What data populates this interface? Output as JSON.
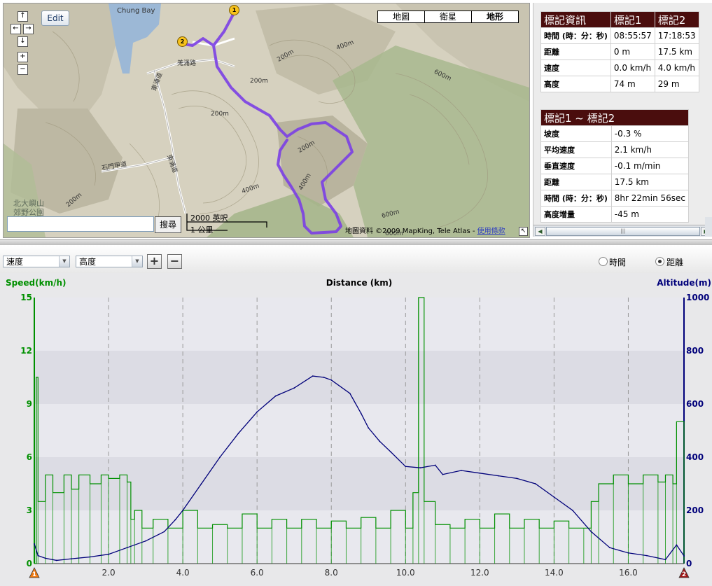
{
  "map": {
    "edit_label": "Edit",
    "map_types": [
      {
        "label": "地圖",
        "selected": false
      },
      {
        "label": "衛星",
        "selected": false
      },
      {
        "label": "地形",
        "selected": true
      }
    ],
    "nav_icons": [
      "arrow-up-icon",
      "arrow-left-icon",
      "arrow-right-icon",
      "arrow-down-icon",
      "zoom-in-icon",
      "zoom-out-icon"
    ],
    "nav_glyphs": {
      "up": "↑",
      "left": "←",
      "right": "→",
      "down": "↓",
      "zoom_in": "+",
      "zoom_out": "−"
    },
    "place_labels": {
      "chung_bay": "Chung Bay",
      "park": "北大嶼山",
      "park2": "郊野公園",
      "road1": "東涌道",
      "road2": "羗涌路",
      "road3": "石門甲道",
      "road4": "東涌道"
    },
    "contour_labels": [
      "200m",
      "400m",
      "600m",
      "200m",
      "200m",
      "400m",
      "200m",
      "400m",
      "600m",
      "200m",
      "600m"
    ],
    "markers": [
      "1",
      "2"
    ],
    "search_placeholder": "",
    "search_value": "",
    "search_button": "搜尋",
    "scale_top": "2000 英呎",
    "scale_bottom": "1 公里",
    "copyright": "地圖資料 ©2009 MapKing, Tele Atlas - ",
    "terms_link": "使用條款",
    "route_color": "#7b3fe4"
  },
  "marker_info": {
    "headers": [
      "標記資訊",
      "標記1",
      "標記2"
    ],
    "rows": [
      {
        "label": "時間 (時：分：秒)",
        "m1": "08:55:57",
        "m2": "17:18:53"
      },
      {
        "label": "距離",
        "m1": "0 m",
        "m2": "17.5 km"
      },
      {
        "label": "速度",
        "m1": "0.0 km/h",
        "m2": "4.0 km/h"
      },
      {
        "label": "高度",
        "m1": "74 m",
        "m2": "29 m"
      }
    ]
  },
  "segment_info": {
    "header": "標記1 ~ 標記2",
    "rows": [
      {
        "label": "坡度",
        "value": "-0.3 %"
      },
      {
        "label": "平均速度",
        "value": "2.1 km/h"
      },
      {
        "label": "垂直速度",
        "value": "-0.1 m/min"
      },
      {
        "label": "距離",
        "value": "17.5 km"
      },
      {
        "label": "時間 (時：分：秒)",
        "value": "8hr 22min 56sec"
      },
      {
        "label": "高度增量",
        "value": "-45 m"
      }
    ]
  },
  "controls": {
    "select1": "速度",
    "select2": "高度",
    "plus": "+",
    "minus": "−",
    "radio_time": "時間",
    "radio_distance": "距離",
    "time_selected": false,
    "distance_selected": true
  },
  "chart_data": {
    "type": "line",
    "title": "Distance (km)",
    "ylabel_left": "Speed(km/h)",
    "ylabel_right": "Altitude(m)",
    "x_range": [
      0,
      17.5
    ],
    "x_ticks": [
      "2.0",
      "4.0",
      "6.0",
      "8.0",
      "10.0",
      "12.0",
      "14.0",
      "16.0"
    ],
    "x_tick_values": [
      2,
      4,
      6,
      8,
      10,
      12,
      14,
      16
    ],
    "y_left_range": [
      0,
      15
    ],
    "y_left_ticks": [
      "0",
      "3",
      "6",
      "9",
      "12",
      "15"
    ],
    "y_right_range": [
      0,
      1000
    ],
    "y_right_ticks": [
      "0",
      "200",
      "400",
      "600",
      "800",
      "1000"
    ],
    "grid": true,
    "markers": [
      "1",
      "2"
    ],
    "marker_x": [
      0,
      17.5
    ],
    "speed_color": "#009000",
    "altitude_color": "#00007a",
    "series": [
      {
        "name": "Speed(km/h)",
        "x": [
          0,
          0.05,
          0.1,
          0.3,
          0.5,
          0.8,
          1.0,
          1.2,
          1.5,
          1.8,
          2.0,
          2.3,
          2.5,
          2.6,
          2.7,
          2.9,
          3.2,
          3.6,
          4.0,
          4.4,
          4.8,
          5.2,
          5.6,
          6.0,
          6.4,
          6.8,
          7.2,
          7.6,
          8.0,
          8.4,
          8.8,
          9.2,
          9.6,
          10.0,
          10.2,
          10.35,
          10.5,
          10.8,
          11.2,
          11.6,
          12.0,
          12.4,
          12.8,
          13.2,
          13.6,
          14.0,
          14.4,
          14.8,
          15.0,
          15.2,
          15.6,
          16.0,
          16.4,
          16.8,
          17.0,
          17.2,
          17.3,
          17.5
        ],
        "values": [
          0,
          10.5,
          3.5,
          5.0,
          4.0,
          5.0,
          4.2,
          5.0,
          4.5,
          5.0,
          4.8,
          5.0,
          4.6,
          2.5,
          3.0,
          2.0,
          2.5,
          2.0,
          3.0,
          2.0,
          2.2,
          2.0,
          2.8,
          2.0,
          2.5,
          2.0,
          2.5,
          2.0,
          2.4,
          2.0,
          2.6,
          2.0,
          3.0,
          2.0,
          4.0,
          15.0,
          3.5,
          2.2,
          2.0,
          2.5,
          2.0,
          2.8,
          2.0,
          2.5,
          2.0,
          2.4,
          2.0,
          2.0,
          3.5,
          4.5,
          5.0,
          4.5,
          5.0,
          4.6,
          5.0,
          4.5,
          8.0,
          0
        ]
      },
      {
        "name": "Altitude(m)",
        "x": [
          0,
          0.1,
          0.3,
          0.6,
          1.0,
          1.5,
          2.0,
          2.5,
          3.0,
          3.5,
          3.8,
          4.0,
          4.5,
          5.0,
          5.5,
          6.0,
          6.5,
          7.0,
          7.5,
          7.8,
          8.0,
          8.5,
          8.8,
          9.0,
          9.3,
          9.6,
          10.0,
          10.4,
          10.8,
          11.0,
          11.5,
          12.0,
          12.5,
          13.0,
          13.5,
          14.0,
          14.5,
          15.0,
          15.5,
          16.0,
          16.5,
          17.0,
          17.3,
          17.5
        ],
        "values": [
          74,
          30,
          20,
          12,
          18,
          25,
          35,
          60,
          85,
          120,
          165,
          200,
          300,
          400,
          490,
          570,
          630,
          660,
          705,
          700,
          690,
          640,
          565,
          510,
          460,
          420,
          365,
          360,
          370,
          335,
          350,
          340,
          330,
          320,
          300,
          250,
          200,
          120,
          60,
          40,
          30,
          15,
          70,
          29
        ]
      }
    ]
  }
}
